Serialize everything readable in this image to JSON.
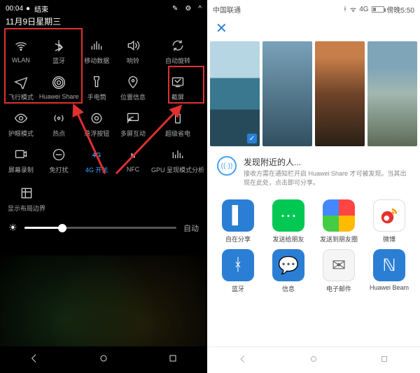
{
  "left": {
    "status": {
      "time": "00:04",
      "rec_icon": "●",
      "end_label": "结束",
      "edit_icon": "✎",
      "settings_icon": "⚙",
      "expand_icon": "^"
    },
    "date": "11月9日星期三",
    "tiles": [
      [
        {
          "label": "WLAN",
          "icon": "wifi",
          "on": false
        },
        {
          "label": "蓝牙",
          "icon": "bluetooth",
          "on": false
        },
        {
          "label": "移动数据",
          "icon": "cell",
          "on": false
        },
        {
          "label": "响铃",
          "icon": "sound",
          "on": false
        },
        {
          "label": "自动旋转",
          "icon": "rotate",
          "on": false
        }
      ],
      [
        {
          "label": "飞行模式",
          "icon": "plane",
          "on": false
        },
        {
          "label": "Huawei Share",
          "icon": "share",
          "on": false
        },
        {
          "label": "手电筒",
          "icon": "torch",
          "on": false
        },
        {
          "label": "位置信息",
          "icon": "location",
          "on": false
        },
        {
          "label": "截屏",
          "icon": "screenshot",
          "on": false
        }
      ],
      [
        {
          "label": "护眼模式",
          "icon": "eye",
          "on": false
        },
        {
          "label": "热点",
          "icon": "hotspot",
          "on": false
        },
        {
          "label": "悬浮按钮",
          "icon": "float",
          "on": false
        },
        {
          "label": "多屏互动",
          "icon": "miracast",
          "on": false
        },
        {
          "label": "超级省电",
          "icon": "battery",
          "on": false
        }
      ],
      [
        {
          "label": "屏幕录制",
          "icon": "record",
          "on": false
        },
        {
          "label": "免打扰",
          "icon": "dnd",
          "on": false
        },
        {
          "label": "4G 开关",
          "icon": "4g",
          "on": true
        },
        {
          "label": "NFC",
          "icon": "nfc",
          "on": false
        },
        {
          "label": "GPU 呈现模式分析",
          "icon": "gpu",
          "on": false
        }
      ]
    ],
    "extra_row_label": "显示布局边界",
    "brightness": {
      "icon": "☀",
      "value_pct": 25,
      "auto_label": "自动"
    }
  },
  "right": {
    "status": {
      "carrier": "中国联通",
      "bt_icon": "ᚼ",
      "signal": "ᯤ",
      "net": "4G",
      "batt_pct": "30",
      "time": "傍晚5:50"
    },
    "close_icon": "✕",
    "thumb_selected_index": 0,
    "notice": {
      "title": "发现附近的人...",
      "desc": "接收方需在通知栏开启 Huawei Share 才可被发现。当其出现在此处，点击即可分享。"
    },
    "share_targets": [
      {
        "label": "自在分享",
        "color": "c-blue",
        "glyph": "▌"
      },
      {
        "label": "发送给朋友",
        "color": "c-wechat",
        "glyph": "⋯"
      },
      {
        "label": "发送到朋友圈",
        "color": "c-rainbow",
        "glyph": ""
      },
      {
        "label": "微博",
        "color": "c-weibo",
        "glyph": ""
      },
      {
        "label": "蓝牙",
        "color": "c-blue",
        "glyph": "ᚼ"
      },
      {
        "label": "信息",
        "color": "c-blue",
        "glyph": "💬"
      },
      {
        "label": "电子邮件",
        "color": "c-mail",
        "glyph": "✉"
      },
      {
        "label": "Huawei Beam",
        "color": "c-nfc",
        "glyph": "ℕ"
      }
    ]
  }
}
